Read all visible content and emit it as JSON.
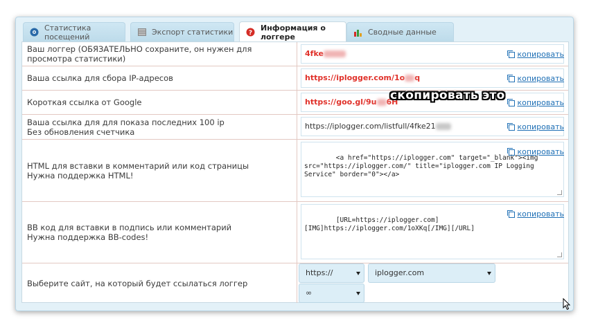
{
  "tabs": [
    {
      "label": "Статистика посещений",
      "icon": "eye-icon"
    },
    {
      "label": "Экспорт статистики",
      "icon": "table-icon"
    },
    {
      "label": "Информация о логгере",
      "icon": "question-icon",
      "active": true
    },
    {
      "label": "Сводные данные",
      "icon": "bar-chart-icon"
    }
  ],
  "rows": [
    {
      "label": "Ваш логгер (ОБЯЗАТЕЛЬНО сохраните, он нужен для просмотра статистики)",
      "value": "4fke",
      "copy": "копировать"
    },
    {
      "label": "Ваша ссылка для сбора IP-адресов",
      "value": "https://iplogger.com/1o",
      "value_tail": "q",
      "copy": "копировать"
    },
    {
      "label": "Короткая ссылка от Google",
      "value": "https://goo.gl/9u",
      "value_tail": "6H",
      "copy": "копировать"
    },
    {
      "label_line1": "Ваша ссылка для для показа последних 100 ip",
      "label_line2": "Без обновления счетчика",
      "value": "https://iplogger.com/listfull/4fke21",
      "copy": "копировать"
    },
    {
      "label_line1": "HTML для вставки в комментарий или код страницы",
      "label_line2": "Нужна поддержка HTML!",
      "value": "<a href=\"https://iplogger.com\" target=\"_blank\"><img src=\"https://iplogger.com/\" title=\"iplogger.com IP Logging Service\" border=\"0\"></a>",
      "copy": "копировать"
    },
    {
      "label_line1": "BB код для вставки в подпись или комментарий",
      "label_line2": "Нужна поддержка BB-codes!",
      "value": "[URL=https://iplogger.com]\n[IMG]https://iplogger.com/1oXKq[/IMG][/URL]",
      "copy": "копировать"
    },
    {
      "label": "Выберите сайт, на который будет ссылаться логгер",
      "protocol": "https://",
      "domain": "iplogger.com",
      "extra": "∞"
    }
  ],
  "overlay_text": "скопировать это",
  "colors": {
    "accent_red": "#e0312a",
    "link_blue": "#1e6fb5",
    "panel_bg": "#e3f1f8"
  }
}
